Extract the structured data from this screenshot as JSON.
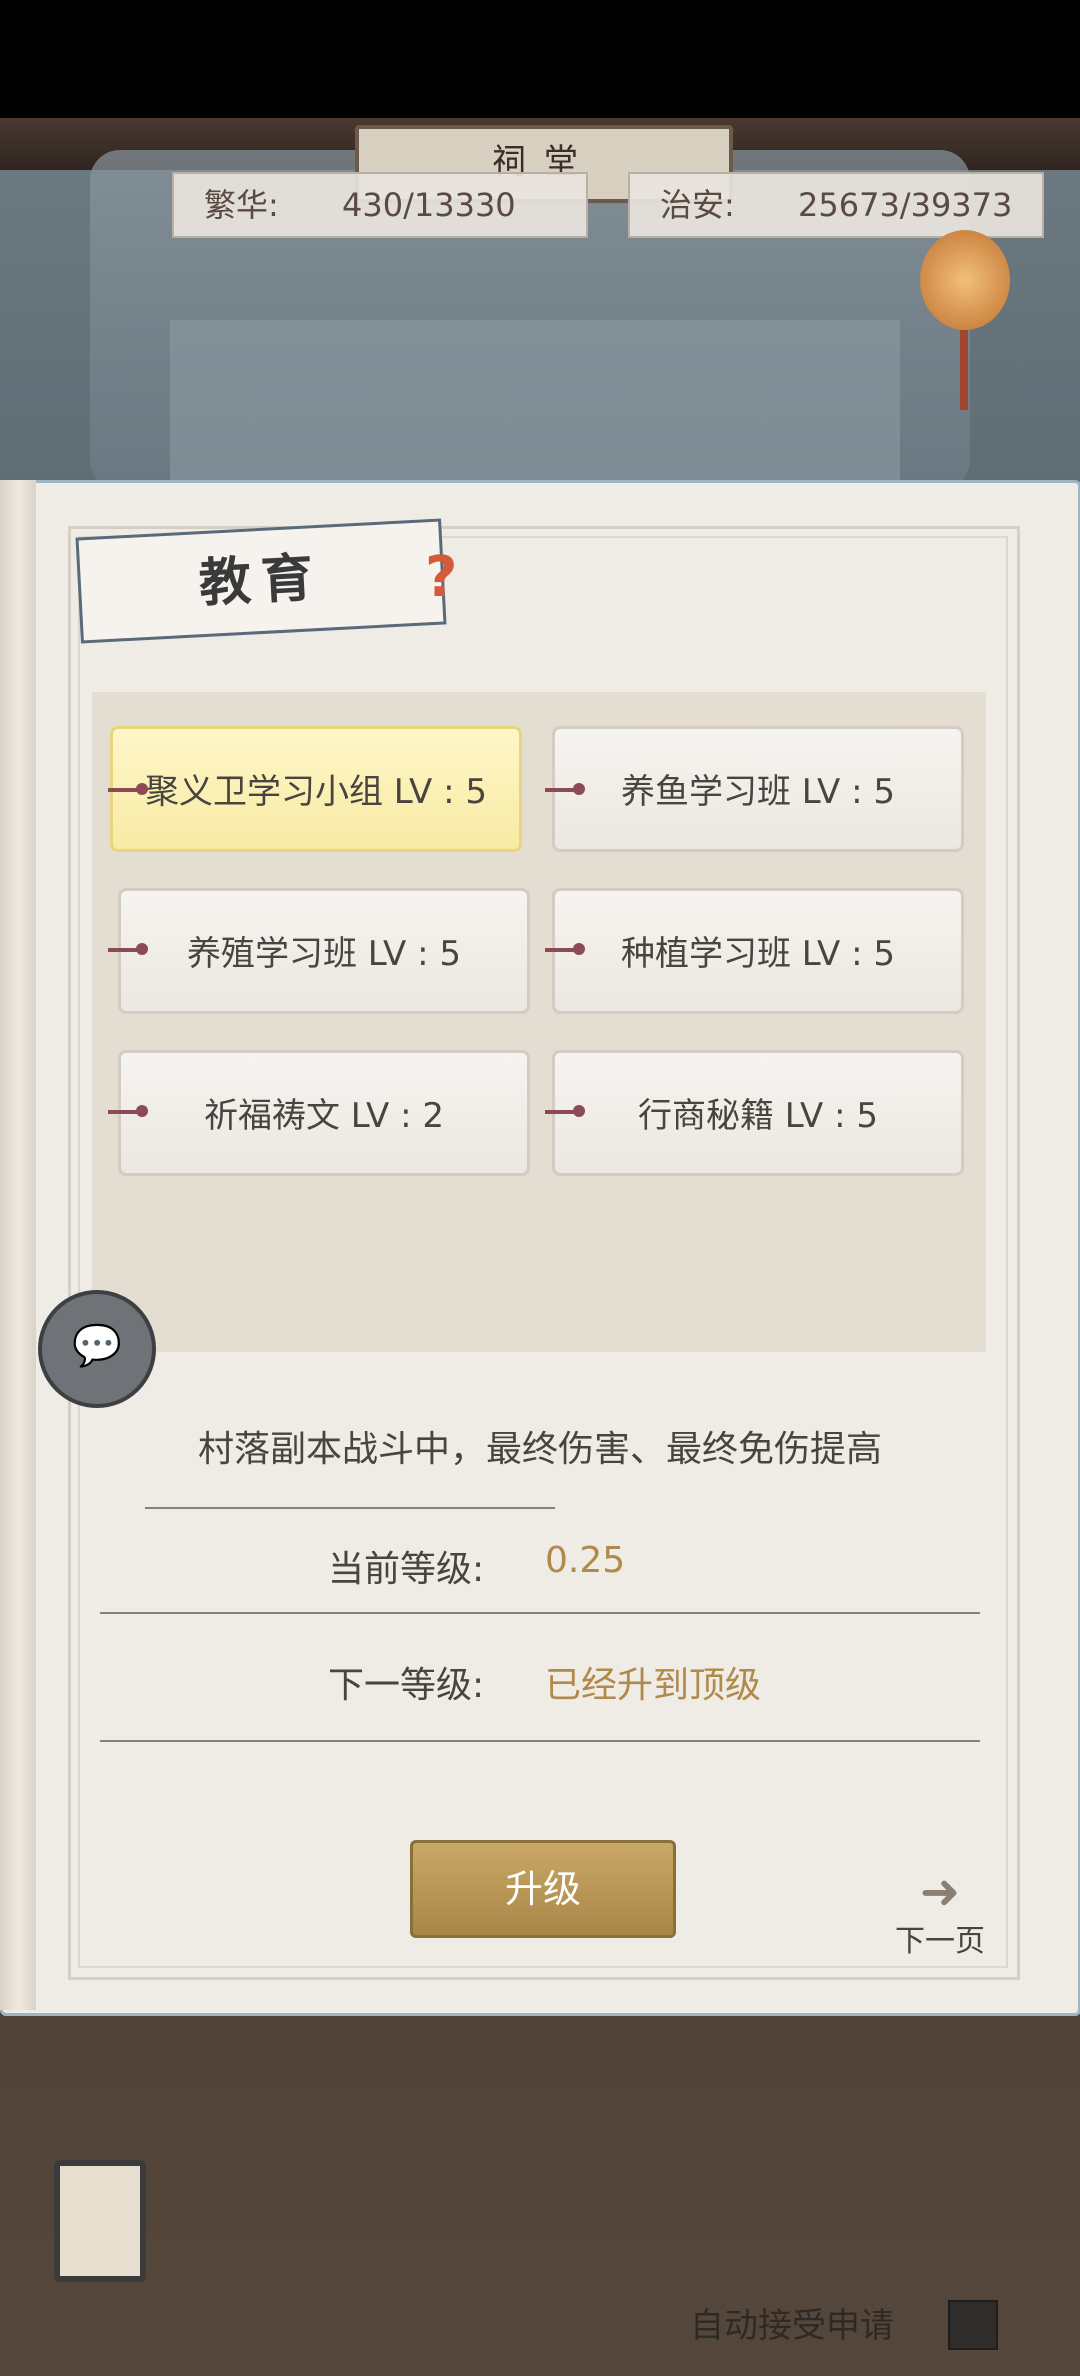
{
  "header": {
    "shrine_title": "祠堂",
    "prosperity_label": "繁华:",
    "prosperity_value": "430/13330",
    "security_label": "治安:",
    "security_value": "25673/39373"
  },
  "panel": {
    "title": "教育",
    "help_icon": "question-icon",
    "skills": [
      {
        "label": "聚义卫学习小组 LV : 5",
        "selected": true
      },
      {
        "label": "养鱼学习班 LV : 5",
        "selected": false
      },
      {
        "label": "养殖学习班 LV : 5",
        "selected": false
      },
      {
        "label": "种植学习班 LV : 5",
        "selected": false
      },
      {
        "label": "祈福祷文 LV : 2",
        "selected": false
      },
      {
        "label": "行商秘籍 LV : 5",
        "selected": false
      }
    ],
    "description": "村落副本战斗中，最终伤害、最终免伤提高",
    "current_level_label": "当前等级:",
    "current_level_value": "0.25",
    "next_level_label": "下一等级:",
    "next_level_value": "已经升到顶级",
    "upgrade_button": "升级",
    "next_page_label": "下一页"
  },
  "footer": {
    "auto_accept_label": "自动接受申请"
  },
  "colors": {
    "accent_gold": "#b08a4a",
    "selected_bg": "#f7eba4",
    "button_gold": "#b8975a"
  }
}
